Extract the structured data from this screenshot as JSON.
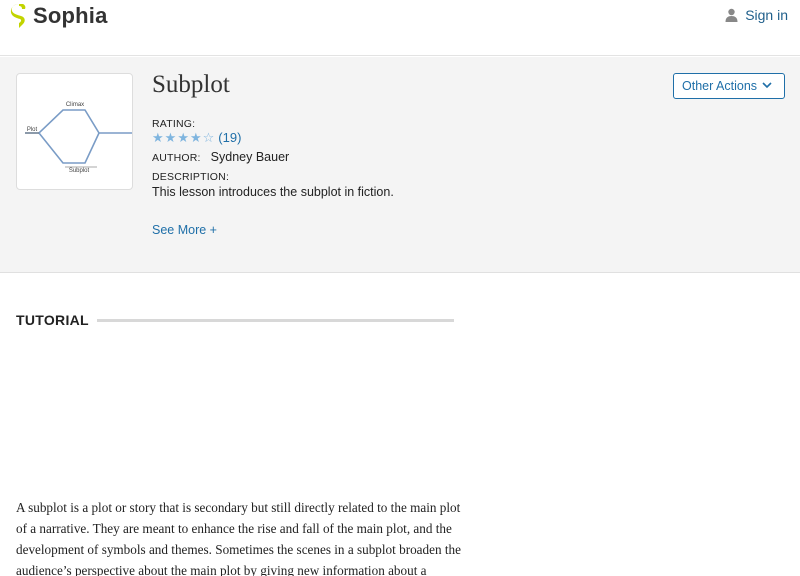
{
  "header": {
    "brand": "Sophia",
    "signin_label": "Sign in",
    "brand_color": "#c2d400"
  },
  "lesson": {
    "title": "Subplot",
    "thumbnail": {
      "climax_label": "Climax",
      "plot_label": "Plot",
      "subplot_label": "Subplot"
    },
    "rating_label": "RATING:",
    "rating_stars": 4,
    "rating_max": 5,
    "rating_count": "(19)",
    "author_label": "AUTHOR:",
    "author_name": "Sydney Bauer",
    "description_label": "DESCRIPTION:",
    "description": "This lesson introduces the subplot in fiction.",
    "see_more": "See More +",
    "other_actions": "Other Actions"
  },
  "tutorial": {
    "heading": "TUTORIAL",
    "paragraph": "A subplot is a plot or story that is secondary but still directly related to the main plot of a narrative. They are meant to enhance the rise and fall of the main plot, and the development of symbols and themes. Sometimes the scenes in a subplot broaden the audience’s perspective about the main plot by giving new information about a character"
  }
}
